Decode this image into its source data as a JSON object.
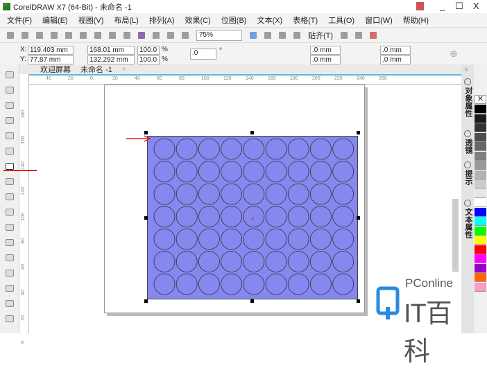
{
  "title": "CorelDRAW X7 (64-Bit) - 未命名 -1",
  "window_controls": [
    "_",
    "☐",
    "X"
  ],
  "menu": [
    "文件(F)",
    "编辑(E)",
    "视图(V)",
    "布局(L)",
    "排列(A)",
    "效果(C)",
    "位图(B)",
    "文本(X)",
    "表格(T)",
    "工具(O)",
    "窗口(W)",
    "帮助(H)"
  ],
  "toolbar": {
    "zoom": "75%",
    "snap": "贴齐(T)"
  },
  "props": {
    "x_label": "X:",
    "x": "119.403 mm",
    "y_label": "Y:",
    "y": "77.87 mm",
    "w": "168.01 mm",
    "h": "132.292 mm",
    "sx": "100.0",
    "sy": "100.0",
    "pct": "%",
    "rotation": ".0",
    "deg": "°",
    "c1": ".0 mm",
    "c2": ".0 mm",
    "c3": ".0 mm",
    "c4": ".0 mm"
  },
  "tabs": [
    "欢迎屏幕",
    "未命名 -1",
    "+"
  ],
  "hruler": [
    "40",
    "20",
    "0",
    "20",
    "40",
    "60",
    "80",
    "100",
    "120",
    "140",
    "160",
    "180",
    "200",
    "220",
    "240",
    "260"
  ],
  "vruler": [
    "180",
    "160",
    "140",
    "120",
    "100",
    "80",
    "60",
    "40",
    "20",
    "0"
  ],
  "dockers": [
    "对象属性",
    "透镜",
    "提示",
    "文本属性"
  ],
  "palette": [
    "#000000",
    "#1a1a1a",
    "#333333",
    "#4d4d4d",
    "#666666",
    "#808080",
    "#999999",
    "#b3b3b3",
    "#cccccc",
    "#e6e6e6",
    "#ffffff",
    "#0000ff",
    "#00ffff",
    "#00ff00",
    "#ffff00",
    "#ff0000",
    "#ff00ff",
    "#9900cc",
    "#ff6600",
    "#ff99cc"
  ],
  "shape": {
    "fill": "#8787f0",
    "rows": 7,
    "cols": 9
  },
  "accent_red": "#e02020",
  "watermark": {
    "brand": "PConline",
    "name": "IT百科"
  }
}
